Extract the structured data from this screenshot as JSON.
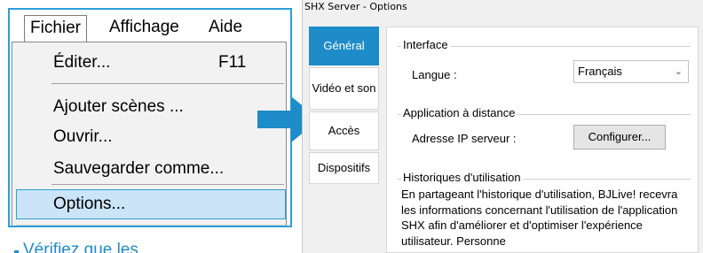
{
  "menu": {
    "menubar": [
      "Fichier",
      "Affichage",
      "Aide"
    ],
    "items": [
      {
        "label": "Éditer...",
        "shortcut": "F11"
      },
      {
        "label": "Ajouter scènes ..."
      },
      {
        "label": "Ouvrir..."
      },
      {
        "label": "Sauvegarder comme..."
      },
      {
        "label": "Options..."
      }
    ],
    "caption_partial": "Vérifiez que les"
  },
  "dialog": {
    "title": "SHX Server - Options",
    "tabs": [
      "Général",
      "Vidéo et son",
      "Accès",
      "Dispositifs"
    ],
    "active_tab": "Général",
    "interface": {
      "group": "Interface",
      "language_label": "Langue :",
      "language_value": "Français"
    },
    "remote": {
      "group": "Application à distance",
      "ip_label": "Adresse IP serveur :",
      "configure_button": "Configurer..."
    },
    "history": {
      "group": "Historiques d'utilisation",
      "text": "En partageant l'historique d'utilisation, BJLive! recevra les informations concernant l'utilisation de l'application SHX afin d'améliorer et d'optimiser l'expérience utilisateur. Personne"
    }
  },
  "colors": {
    "accent": "#1e8cc8",
    "menu_highlight": "#cce4f7",
    "frame_border": "#2a9fd6"
  },
  "icons": {
    "arrow": "right-arrow-icon",
    "dropdown": "chevron-down-icon"
  }
}
